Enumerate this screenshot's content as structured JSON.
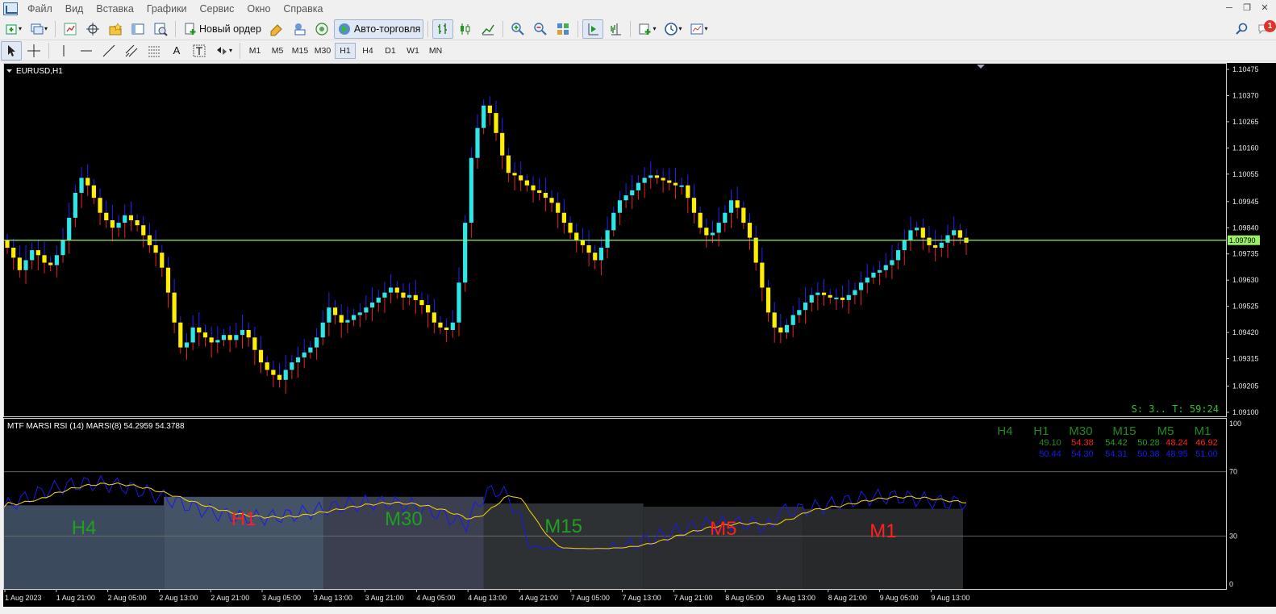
{
  "menu": {
    "items": [
      "Файл",
      "Вид",
      "Вставка",
      "Графики",
      "Сервис",
      "Окно",
      "Справка"
    ]
  },
  "toolbar": {
    "new_order": "Новый ордер",
    "auto_trading": "Авто-торговля",
    "notification_count": "1"
  },
  "timeframes": [
    "M1",
    "M5",
    "M15",
    "M30",
    "H1",
    "H4",
    "D1",
    "W1",
    "MN"
  ],
  "active_timeframe": "H1",
  "chart": {
    "symbol": "EURUSD,H1",
    "current_price": "1.09790",
    "timer": "S: 3.. T: 59:24",
    "price_ticks": [
      "1.10475",
      "1.10370",
      "1.10265",
      "1.10160",
      "1.10055",
      "1.09945",
      "1.09840",
      "1.09735",
      "1.09630",
      "1.09525",
      "1.09420",
      "1.09315",
      "1.09205",
      "1.09100"
    ],
    "time_ticks": [
      "1 Aug 2023",
      "1 Aug 21:00",
      "2 Aug 05:00",
      "2 Aug 13:00",
      "2 Aug 21:00",
      "3 Aug 05:00",
      "3 Aug 13:00",
      "3 Aug 21:00",
      "4 Aug 05:00",
      "4 Aug 13:00",
      "4 Aug 21:00",
      "7 Aug 05:00",
      "7 Aug 13:00",
      "7 Aug 21:00",
      "8 Aug 05:00",
      "8 Aug 13:00",
      "8 Aug 21:00",
      "9 Aug 05:00",
      "9 Aug 13:00"
    ],
    "colors": {
      "bull": "#2ee6e6",
      "bear": "#ffee00",
      "price_line": "#9aee6a",
      "wick_bull": "#2222ff",
      "wick_bear": "#ee2222"
    }
  },
  "indicator": {
    "title": "MTF MARSI  RSI (14)  MARSI(8) 54.2959 54.3788",
    "scale_ticks": [
      "100",
      "70",
      "30",
      "0"
    ],
    "levels": [
      70,
      30
    ],
    "tf_headers": [
      "H4",
      "H1",
      "M30",
      "M15",
      "M5",
      "M1"
    ],
    "rsi_values": [
      "49.10",
      "54.38",
      "54.42",
      "50.28",
      "48.24",
      "46.92"
    ],
    "marsi_values": [
      "50.44",
      "54.30",
      "54.31",
      "50.38",
      "48.95",
      "51.00"
    ],
    "rsi_colors": [
      "#20a020",
      "#ff2020",
      "#20a020",
      "#20a020",
      "#ff2020",
      "#ff2020"
    ],
    "zone_labels": [
      "H4",
      "H1",
      "M30",
      "M15",
      "M5",
      "M1"
    ],
    "zone_label_colors": [
      "#20a020",
      "#ff2020",
      "#20a020",
      "#20a020",
      "#ff2020",
      "#ff2020"
    ]
  }
}
